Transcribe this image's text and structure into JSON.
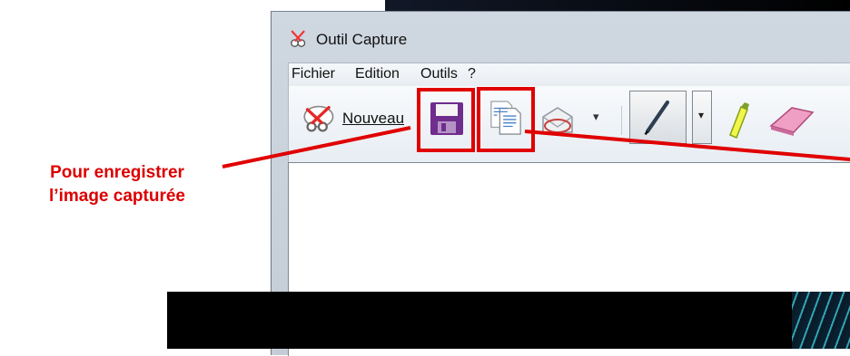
{
  "window": {
    "title": "Outil Capture",
    "app_icon": "scissors-icon"
  },
  "menu": [
    {
      "label": "Fichier"
    },
    {
      "label": "Edition"
    },
    {
      "label": "Outils"
    },
    {
      "label": "?"
    }
  ],
  "toolbar": {
    "new_label": "Nouveau",
    "new_icon": "scissors-icon",
    "save_icon": "save-icon",
    "copy_icon": "copy-icon",
    "send_icon": "mail-icon",
    "pen_icon": "pen-icon",
    "highlighter_icon": "highlighter-icon",
    "eraser_icon": "eraser-icon"
  },
  "annotations": {
    "save_line1": "Pour enregistrer",
    "save_line2": "l’image capturée",
    "color": "#e00000"
  }
}
